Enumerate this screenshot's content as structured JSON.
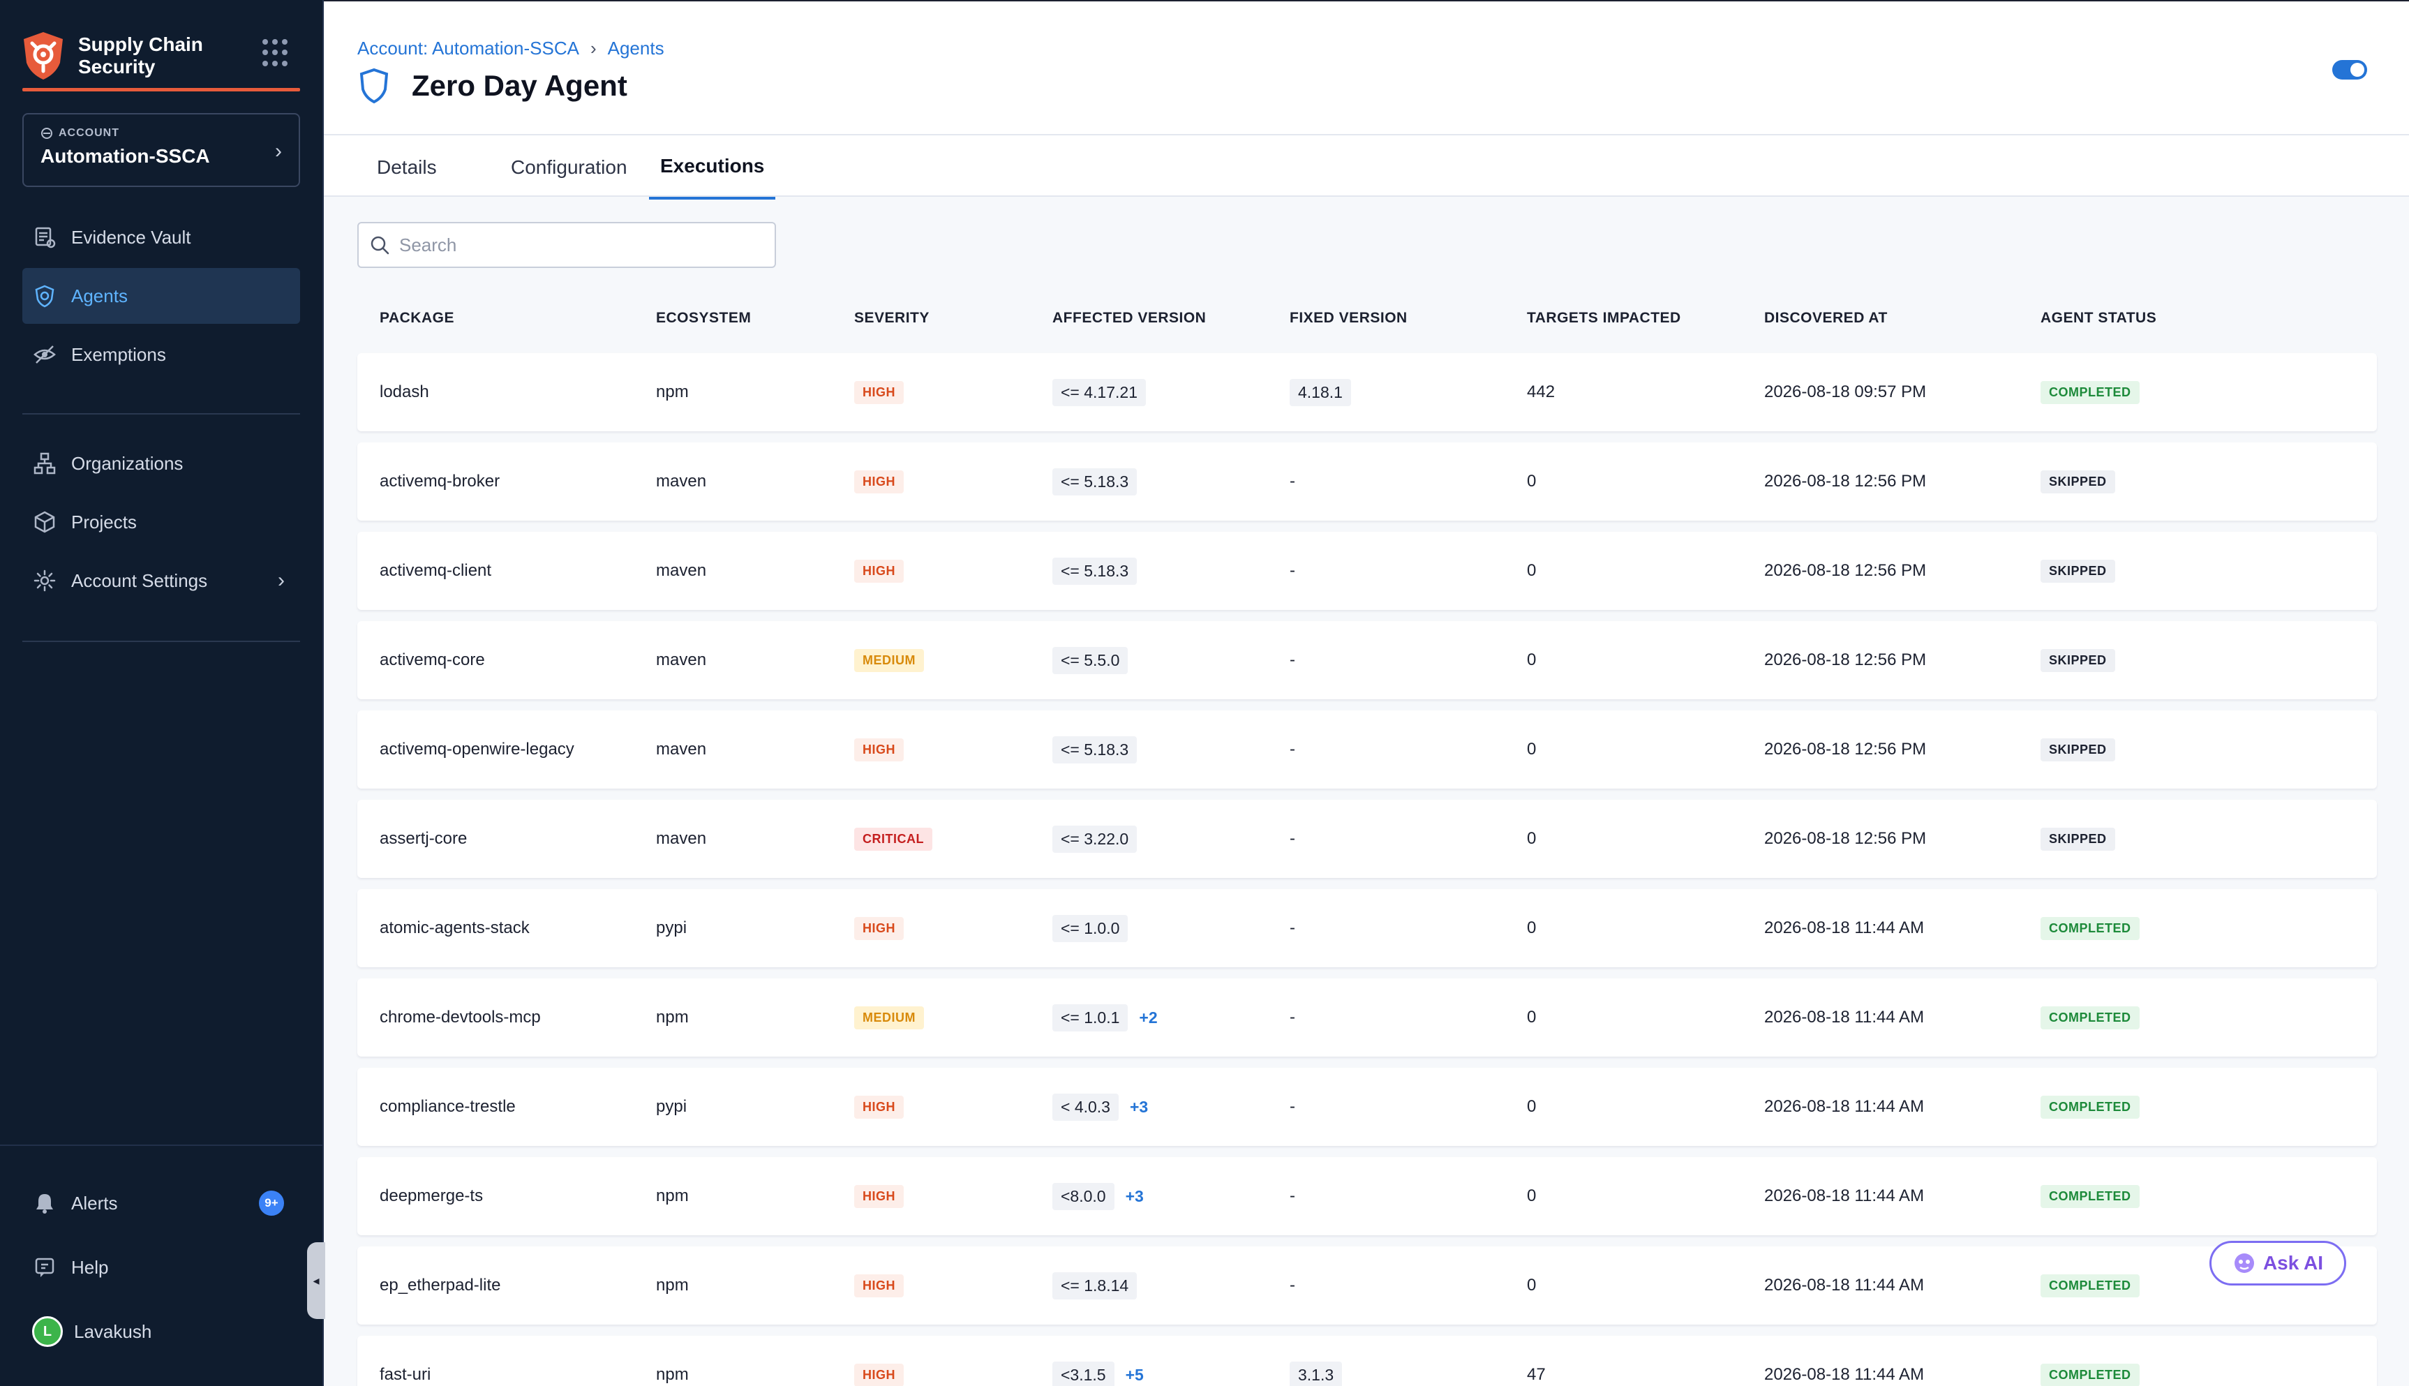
{
  "app": {
    "name": "Supply Chain Security",
    "accent": "#e75b3b"
  },
  "account": {
    "label": "ACCOUNT",
    "name": "Automation-SSCA"
  },
  "sidebar": {
    "items": [
      {
        "label": "Evidence Vault",
        "icon": "evidence-vault-icon",
        "active": false
      },
      {
        "label": "Agents",
        "icon": "agents-icon",
        "active": true
      },
      {
        "label": "Exemptions",
        "icon": "exemptions-icon",
        "active": false
      },
      {
        "label": "Organizations",
        "icon": "organizations-icon",
        "active": false
      },
      {
        "label": "Projects",
        "icon": "projects-icon",
        "active": false
      },
      {
        "label": "Account Settings",
        "icon": "gear-icon",
        "active": false
      }
    ],
    "bottom": {
      "alerts": "Alerts",
      "alerts_count": "9+",
      "help": "Help",
      "user": "Lavakush",
      "user_initial": "L"
    }
  },
  "header": {
    "breadcrumb": [
      "Account: Automation-SSCA",
      "Agents"
    ],
    "title": "Zero Day Agent",
    "tabs": [
      "Details",
      "Configuration",
      "Executions"
    ],
    "active_tab": "Executions"
  },
  "search": {
    "placeholder": "Search"
  },
  "table": {
    "columns": [
      "PACKAGE",
      "ECOSYSTEM",
      "SEVERITY",
      "AFFECTED VERSION",
      "FIXED VERSION",
      "TARGETS IMPACTED",
      "DISCOVERED AT",
      "AGENT STATUS"
    ],
    "rows": [
      {
        "package": "lodash",
        "ecosystem": "npm",
        "severity": "HIGH",
        "affected": "<= 4.17.21",
        "more": "",
        "fixed": "4.18.1",
        "targets": "442",
        "discovered": "2026-08-18 09:57 PM",
        "status": "COMPLETED"
      },
      {
        "package": "activemq-broker",
        "ecosystem": "maven",
        "severity": "HIGH",
        "affected": "<= 5.18.3",
        "more": "",
        "fixed": "-",
        "targets": "0",
        "discovered": "2026-08-18 12:56 PM",
        "status": "SKIPPED"
      },
      {
        "package": "activemq-client",
        "ecosystem": "maven",
        "severity": "HIGH",
        "affected": "<= 5.18.3",
        "more": "",
        "fixed": "-",
        "targets": "0",
        "discovered": "2026-08-18 12:56 PM",
        "status": "SKIPPED"
      },
      {
        "package": "activemq-core",
        "ecosystem": "maven",
        "severity": "MEDIUM",
        "affected": "<= 5.5.0",
        "more": "",
        "fixed": "-",
        "targets": "0",
        "discovered": "2026-08-18 12:56 PM",
        "status": "SKIPPED"
      },
      {
        "package": "activemq-openwire-legacy",
        "ecosystem": "maven",
        "severity": "HIGH",
        "affected": "<= 5.18.3",
        "more": "",
        "fixed": "-",
        "targets": "0",
        "discovered": "2026-08-18 12:56 PM",
        "status": "SKIPPED"
      },
      {
        "package": "assertj-core",
        "ecosystem": "maven",
        "severity": "CRITICAL",
        "affected": "<= 3.22.0",
        "more": "",
        "fixed": "-",
        "targets": "0",
        "discovered": "2026-08-18 12:56 PM",
        "status": "SKIPPED"
      },
      {
        "package": "atomic-agents-stack",
        "ecosystem": "pypi",
        "severity": "HIGH",
        "affected": "<= 1.0.0",
        "more": "",
        "fixed": "-",
        "targets": "0",
        "discovered": "2026-08-18 11:44 AM",
        "status": "COMPLETED"
      },
      {
        "package": "chrome-devtools-mcp",
        "ecosystem": "npm",
        "severity": "MEDIUM",
        "affected": "<= 1.0.1",
        "more": "+2",
        "fixed": "-",
        "targets": "0",
        "discovered": "2026-08-18 11:44 AM",
        "status": "COMPLETED"
      },
      {
        "package": "compliance-trestle",
        "ecosystem": "pypi",
        "severity": "HIGH",
        "affected": "< 4.0.3",
        "more": "+3",
        "fixed": "-",
        "targets": "0",
        "discovered": "2026-08-18 11:44 AM",
        "status": "COMPLETED"
      },
      {
        "package": "deepmerge-ts",
        "ecosystem": "npm",
        "severity": "HIGH",
        "affected": "<8.0.0",
        "more": "+3",
        "fixed": "-",
        "targets": "0",
        "discovered": "2026-08-18 11:44 AM",
        "status": "COMPLETED"
      },
      {
        "package": "ep_etherpad-lite",
        "ecosystem": "npm",
        "severity": "HIGH",
        "affected": "<= 1.8.14",
        "more": "",
        "fixed": "-",
        "targets": "0",
        "discovered": "2026-08-18 11:44 AM",
        "status": "COMPLETED"
      },
      {
        "package": "fast-uri",
        "ecosystem": "npm",
        "severity": "HIGH",
        "affected": "<3.1.5",
        "more": "+5",
        "fixed": "3.1.3",
        "targets": "47",
        "discovered": "2026-08-18 11:44 AM",
        "status": "COMPLETED"
      }
    ]
  },
  "ask_ai": {
    "label": "Ask AI"
  },
  "toggle": {
    "on": true
  }
}
